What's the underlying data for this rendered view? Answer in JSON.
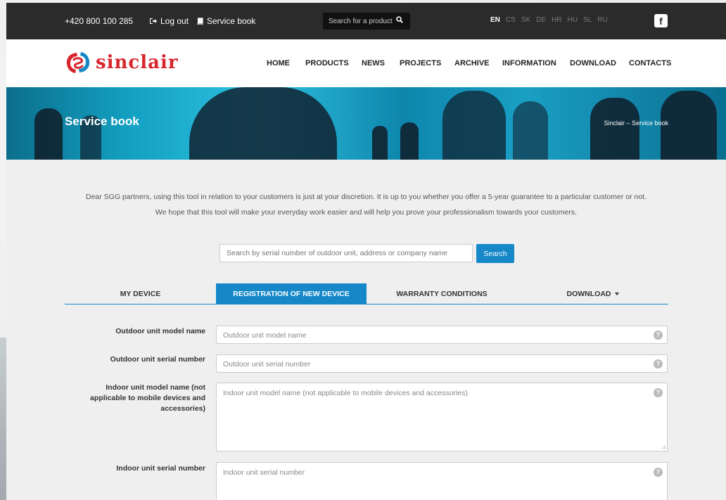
{
  "topbar": {
    "phone": "+420 800 100 285",
    "logout": "Log out",
    "service_book": "Service book",
    "search_placeholder": "Search for a product",
    "languages": [
      "EN",
      "CS",
      "SK",
      "DE",
      "HR",
      "HU",
      "SL",
      "RU"
    ],
    "active_language": "EN",
    "facebook_glyph": "f"
  },
  "brand": {
    "name": "sinclair"
  },
  "nav": {
    "items": [
      "HOME",
      "PRODUCTS",
      "NEWS",
      "PROJECTS",
      "ARCHIVE",
      "INFORMATION",
      "DOWNLOAD",
      "CONTACTS"
    ]
  },
  "hero": {
    "title": "Service book",
    "breadcrumb": "Sinclair – Service book"
  },
  "intro": {
    "line1": "Dear SGG partners, using this tool in relation to your customers is just at your discretion. It is up to you whether you offer a 5-year guarantee to a particular customer or not.",
    "line2": "We hope that this tool will make your everyday work easier and will help you prove your professionalism towards your customers."
  },
  "search": {
    "placeholder": "Search by serial number of outdoor unit, address or company name",
    "button": "Search"
  },
  "tabs": [
    {
      "label": "MY DEVICE",
      "active": false
    },
    {
      "label": "REGISTRATION OF NEW DEVICE",
      "active": true
    },
    {
      "label": "WARRANTY CONDITIONS",
      "active": false
    },
    {
      "label": "DOWNLOAD",
      "active": false,
      "dropdown": true
    }
  ],
  "form": {
    "outdoor_model_label": "Outdoor unit model name",
    "outdoor_model_placeholder": "Outdoor unit model name",
    "outdoor_serial_label": "Outdoor unit serial number",
    "outdoor_serial_placeholder": "Outdoor unit serial number",
    "indoor_model_label": "Indoor unit model name (not applicable to mobile devices and accessories)",
    "indoor_model_placeholder": "Indoor unit model name (not applicable to mobile devices and accessories)",
    "indoor_serial_label": "Indoor unit serial number",
    "indoor_serial_placeholder": "Indoor unit serial number",
    "help_glyph": "?"
  },
  "colors": {
    "accent": "#1688c8",
    "topbar": "#2b2b2b",
    "brand_red": "#d8262e"
  },
  "icons": [
    "logout-icon",
    "book-icon",
    "search-icon",
    "facebook-icon",
    "help-icon",
    "caret-down-icon"
  ]
}
